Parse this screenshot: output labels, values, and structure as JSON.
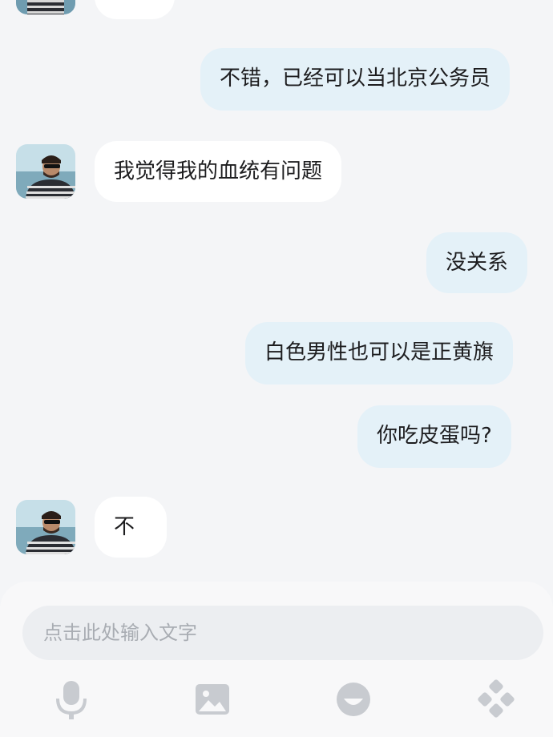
{
  "messages": [
    {
      "from": "me",
      "text": "不错，已经可以当北京公务员"
    },
    {
      "from": "them",
      "text": "我觉得我的血统有问题"
    },
    {
      "from": "me",
      "text": "没关系"
    },
    {
      "from": "me",
      "text": "白色男性也可以是正黄旗"
    },
    {
      "from": "me",
      "text": "你吃皮蛋吗?"
    },
    {
      "from": "them",
      "text": "不"
    }
  ],
  "composer": {
    "placeholder": "点击此处输入文字",
    "icons": [
      "microphone-icon",
      "image-icon",
      "emoji-icon",
      "more-icon"
    ]
  },
  "colors": {
    "background": "#f4f5f7",
    "my_bubble": "#e4f1f8",
    "their_bubble": "#ffffff",
    "icon": "#c8cbd0"
  }
}
